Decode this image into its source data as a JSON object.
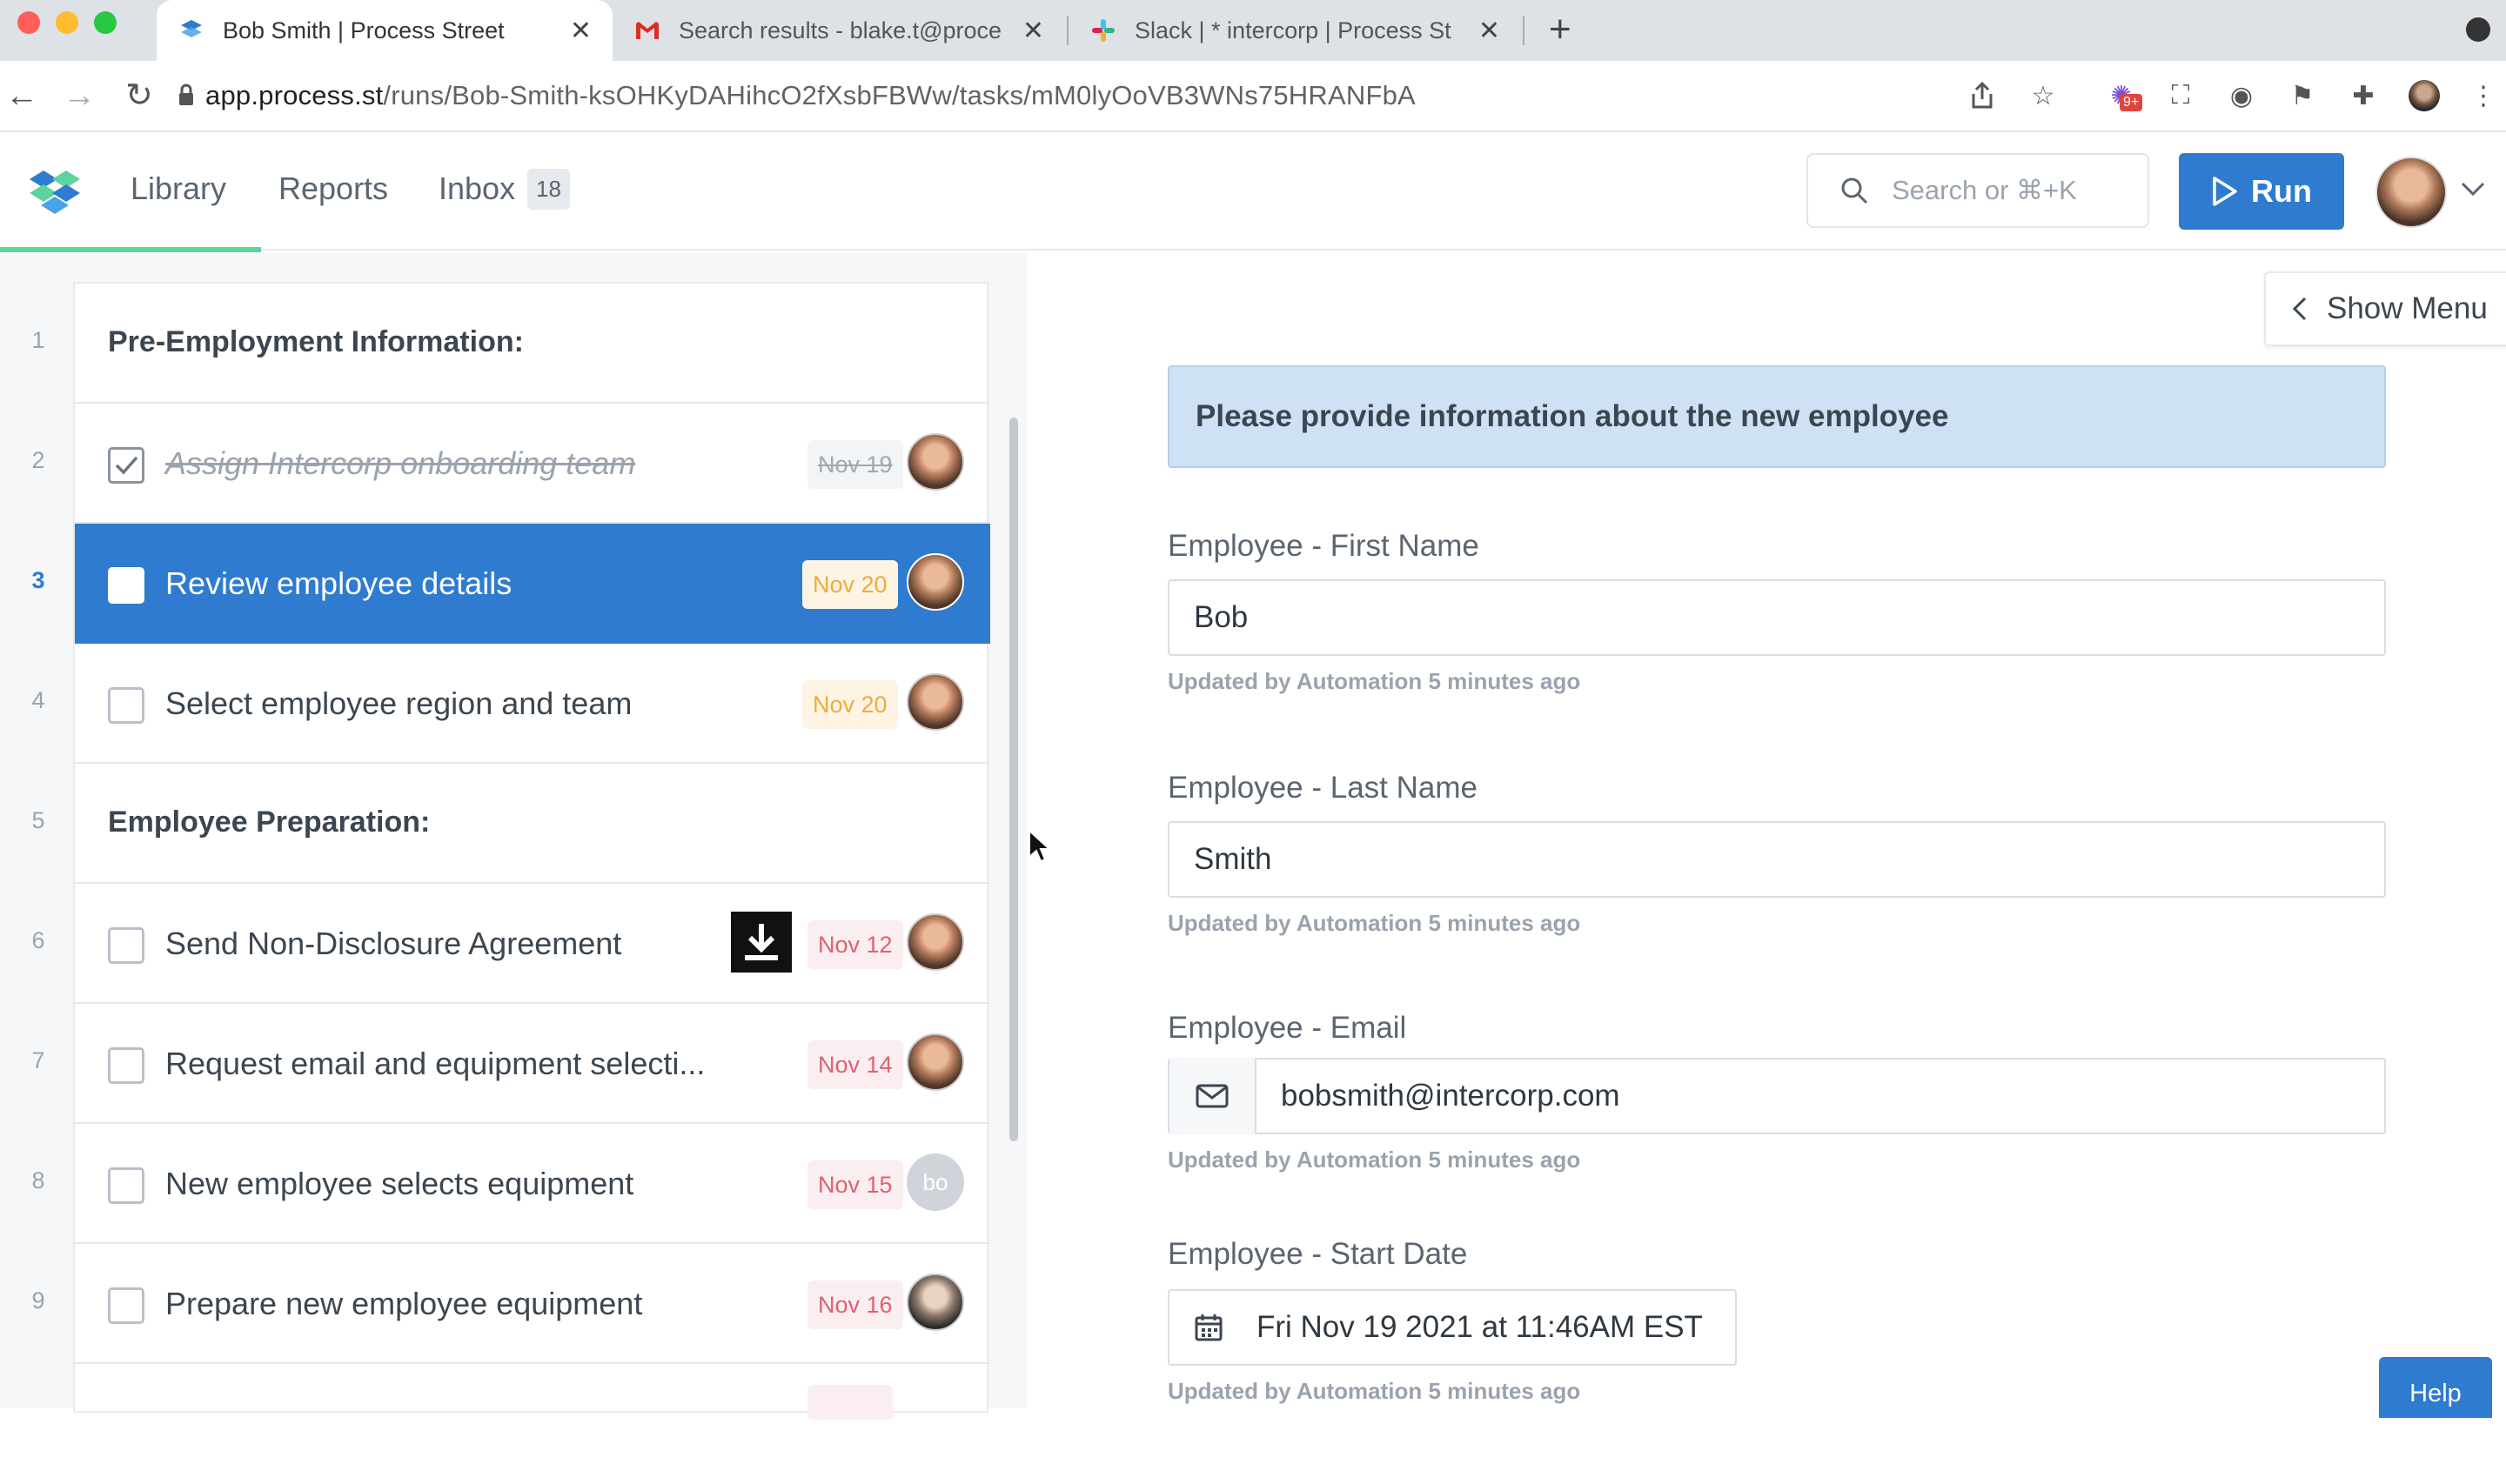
{
  "browser": {
    "tabs": [
      {
        "title": "Bob Smith | Process Street",
        "active": true
      },
      {
        "title": "Search results - blake.t@proce",
        "active": false
      },
      {
        "title": "Slack | * intercorp | Process St",
        "active": false
      }
    ],
    "url_host": "app.process.st",
    "url_path": "/runs/Bob-Smith-ksOHKyDAHihcO2fXsbFBWw/tasks/mM0lyOoVB3WNs75HRANFbA",
    "extension_badge": "9+"
  },
  "app": {
    "nav": {
      "library": "Library",
      "reports": "Reports",
      "inbox": "Inbox",
      "inbox_count": "18"
    },
    "search_placeholder": "Search or ⌘+K",
    "run_label": "Run",
    "accent_color": "#2e7bcf"
  },
  "tasks": [
    {
      "num": "1",
      "type": "heading",
      "text": "Pre-Employment Information:"
    },
    {
      "num": "2",
      "type": "task",
      "text": "Assign Intercorp onboarding team",
      "due": "Nov 19",
      "done": true
    },
    {
      "num": "3",
      "type": "task",
      "text": "Review employee details",
      "due": "Nov 20",
      "selected": true
    },
    {
      "num": "4",
      "type": "task",
      "text": "Select employee region and team",
      "due": "Nov 20"
    },
    {
      "num": "5",
      "type": "heading",
      "text": "Employee Preparation:"
    },
    {
      "num": "6",
      "type": "task",
      "text": "Send Non-Disclosure Agreement",
      "due": "Nov 12"
    },
    {
      "num": "7",
      "type": "task",
      "text": "Request email and equipment selecti...",
      "due": "Nov 14"
    },
    {
      "num": "8",
      "type": "task",
      "text": "New employee selects equipment",
      "due": "Nov 15",
      "assignee_initials": "bo"
    },
    {
      "num": "9",
      "type": "task",
      "text": "Prepare new employee equipment",
      "due": "Nov 16"
    }
  ],
  "form": {
    "show_menu": "Show Menu",
    "banner": "Please provide information about the new employee",
    "fields": [
      {
        "label": "Employee - First Name",
        "value": "Bob",
        "meta": "Updated by Automation 5 minutes ago"
      },
      {
        "label": "Employee - Last Name",
        "value": "Smith",
        "meta": "Updated by Automation 5 minutes ago"
      },
      {
        "label": "Employee - Email",
        "value": "bobsmith@intercorp.com",
        "meta": "Updated by Automation 5 minutes ago"
      },
      {
        "label": "Employee - Start Date",
        "value": "Fri Nov 19 2021 at 11:46AM EST",
        "meta": "Updated by Automation 5 minutes ago"
      }
    ],
    "help": "Help"
  }
}
